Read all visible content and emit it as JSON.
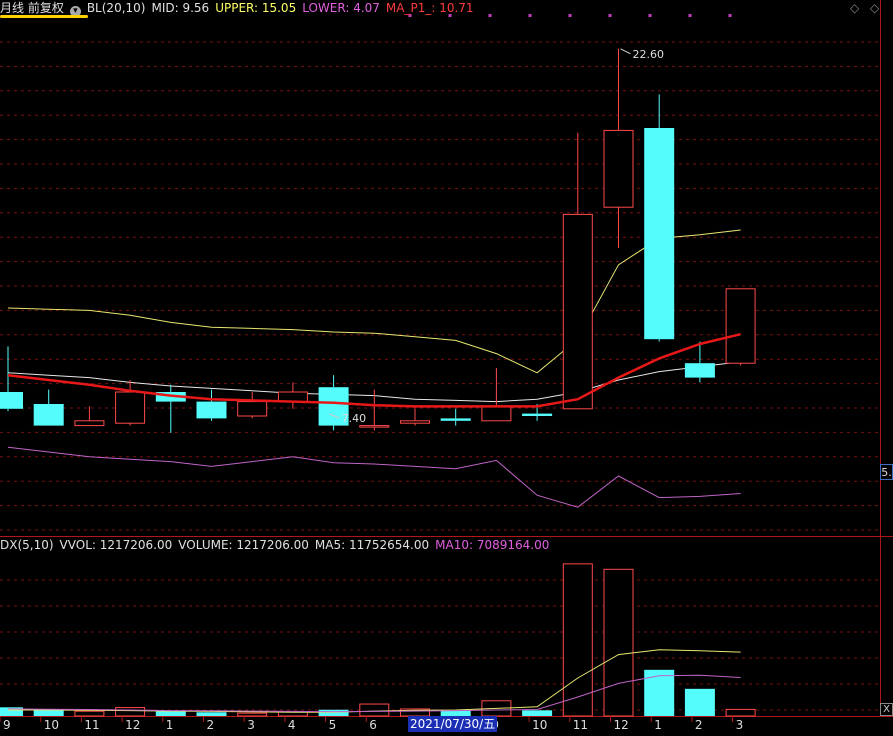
{
  "header": {
    "period": "月线 前复权",
    "dropdown_icon": "chevron-down-icon",
    "indicator": "BL(20,10)",
    "mid": "MID: 9.56",
    "upper": "UPPER: 15.05",
    "lower": "LOWER: 4.07",
    "ma_p1": "MA_P1_: 10.71",
    "right_icons": [
      "◇",
      "◇"
    ]
  },
  "volume_header": {
    "indicator": "DX(5,10)",
    "vvol": "VVOL: 1217206.00",
    "volume": "VOLUME: 1217206.00",
    "ma5": "MA5: 11752654.00",
    "ma10": "MA10: 7089164.00"
  },
  "right_price_label": "5.",
  "close_label": "X",
  "date_badge": "2021/07/30/五",
  "colors": {
    "up": "#ff4a4a",
    "down": "#54fcfc",
    "mid_line": "#e8e8e8",
    "upper_line": "#e8e870",
    "lower_line": "#c064c8",
    "ma_line": "#e81818",
    "vol_ma5": "#e8e870",
    "vol_ma10": "#c064c8",
    "grid": "#7a1010",
    "axis": "#b01818"
  },
  "chart_data": [
    {
      "type": "candlestick",
      "title": "BL(20,10)",
      "x_ticks": [
        "9",
        "10",
        "11",
        "12",
        "1",
        "2",
        "3",
        "4",
        "5",
        "6",
        "2021/07/30/五",
        "9",
        "10",
        "11",
        "12",
        "1",
        "2",
        "3"
      ],
      "candles": [
        {
          "open": 8.3,
          "close": 7.6,
          "high": 10.2,
          "low": 7.5
        },
        {
          "open": 7.8,
          "close": 6.9,
          "high": 8.4,
          "low": 6.9
        },
        {
          "open": 6.9,
          "close": 7.1,
          "high": 7.7,
          "low": 6.9
        },
        {
          "open": 7.0,
          "close": 8.3,
          "high": 8.8,
          "low": 6.9
        },
        {
          "open": 8.3,
          "close": 7.9,
          "high": 8.6,
          "low": 6.6
        },
        {
          "open": 7.9,
          "close": 7.2,
          "high": 8.4,
          "low": 7.1
        },
        {
          "open": 7.3,
          "close": 7.9,
          "high": 8.3,
          "low": 7.2
        },
        {
          "open": 7.9,
          "close": 8.3,
          "high": 8.7,
          "low": 7.6
        },
        {
          "open": 8.5,
          "close": 6.9,
          "high": 9.0,
          "low": 6.7
        },
        {
          "open": 6.9,
          "close": 6.9,
          "high": 8.4,
          "low": 6.7
        },
        {
          "open": 7.0,
          "close": 7.1,
          "high": 7.6,
          "low": 6.9
        },
        {
          "open": 7.2,
          "close": 7.1,
          "high": 7.6,
          "low": 6.9
        },
        {
          "open": 7.1,
          "close": 7.7,
          "high": 9.3,
          "low": 7.1
        },
        {
          "open": 7.4,
          "close": 7.3,
          "high": 7.8,
          "low": 7.1
        },
        {
          "open": 7.6,
          "close": 15.7,
          "high": 19.1,
          "low": 7.6
        },
        {
          "open": 16.0,
          "close": 19.2,
          "high": 22.6,
          "low": 14.3
        },
        {
          "open": 19.3,
          "close": 10.5,
          "high": 20.7,
          "low": 10.4
        },
        {
          "open": 9.5,
          "close": 8.9,
          "high": 10.4,
          "low": 8.7
        },
        {
          "open": 9.5,
          "close": 12.6,
          "high": 12.6,
          "low": 9.4
        }
      ],
      "mid": [
        9.1,
        9.0,
        8.9,
        8.7,
        8.55,
        8.45,
        8.35,
        8.25,
        8.2,
        8.15,
        8.0,
        7.95,
        7.9,
        8.0,
        8.3,
        8.8,
        9.15,
        9.35,
        9.56
      ],
      "upper": [
        11.8,
        11.75,
        11.7,
        11.5,
        11.2,
        11.0,
        10.95,
        10.9,
        10.8,
        10.75,
        10.6,
        10.45,
        9.9,
        9.1,
        10.5,
        13.6,
        14.7,
        14.85,
        15.05
      ],
      "lower": [
        6.0,
        5.8,
        5.6,
        5.5,
        5.4,
        5.2,
        5.4,
        5.6,
        5.35,
        5.3,
        5.2,
        5.1,
        5.45,
        4.0,
        3.5,
        4.8,
        3.9,
        3.95,
        4.07
      ],
      "ma_p1": [
        9.0,
        8.8,
        8.6,
        8.35,
        8.15,
        8.0,
        7.95,
        7.9,
        7.85,
        7.75,
        7.7,
        7.7,
        7.7,
        7.7,
        8.0,
        8.9,
        9.7,
        10.3,
        10.71
      ],
      "annotations": [
        {
          "text": "22.60"
        },
        {
          "text": "7.40"
        }
      ],
      "ylim": [
        2.3,
        23.8
      ]
    },
    {
      "type": "bar",
      "title": "DX(5,10)",
      "volumes": [
        1600000,
        1150000,
        880000,
        1550000,
        850000,
        690000,
        520000,
        760000,
        1150000,
        2200000,
        1300000,
        1100000,
        2800000,
        1050000,
        28000000,
        27000000,
        8500000,
        5000000,
        1217206
      ],
      "ma5": [
        1100000,
        1100000,
        1050000,
        1000000,
        900000,
        850000,
        750000,
        700000,
        700000,
        900000,
        1050000,
        1100000,
        1400000,
        1700000,
        7000000,
        11300000,
        12200000,
        12000000,
        11752654
      ],
      "ma10": [
        1300000,
        1250000,
        1200000,
        1100000,
        1000000,
        950000,
        900000,
        850000,
        800000,
        850000,
        900000,
        1000000,
        1100000,
        1200000,
        3500000,
        6000000,
        7400000,
        7500000,
        7089164
      ],
      "ylim": [
        0,
        30000000
      ]
    }
  ]
}
